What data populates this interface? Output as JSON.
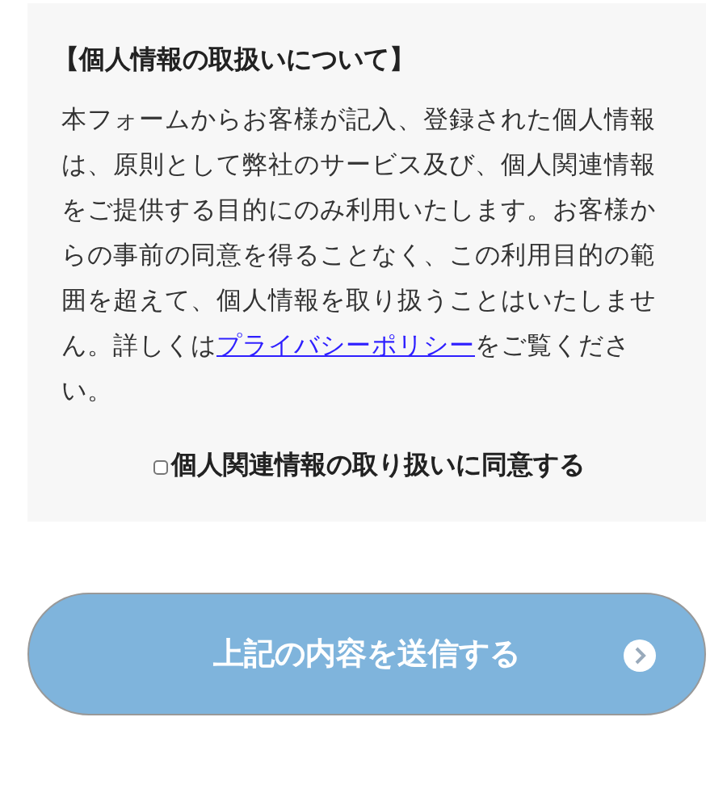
{
  "notice": {
    "heading": "【個人情報の取扱いについて】",
    "body_before": "本フォームからお客様が記入、登録された個人情報は、原則として弊社のサービス及び、個人関連情報をご提供する目的にのみ利用いたします。お客様からの事前の同意を得ることなく、この利用目的の範囲を超えて、個人情報を取り扱うことはいたしません。詳しくは",
    "link": "プライバシーポリシー",
    "body_after": "をご覧ください。"
  },
  "consent": {
    "label": "個人関連情報の取り扱いに同意する",
    "checked": false
  },
  "submit_button": {
    "label": "上記の内容を送信する"
  }
}
